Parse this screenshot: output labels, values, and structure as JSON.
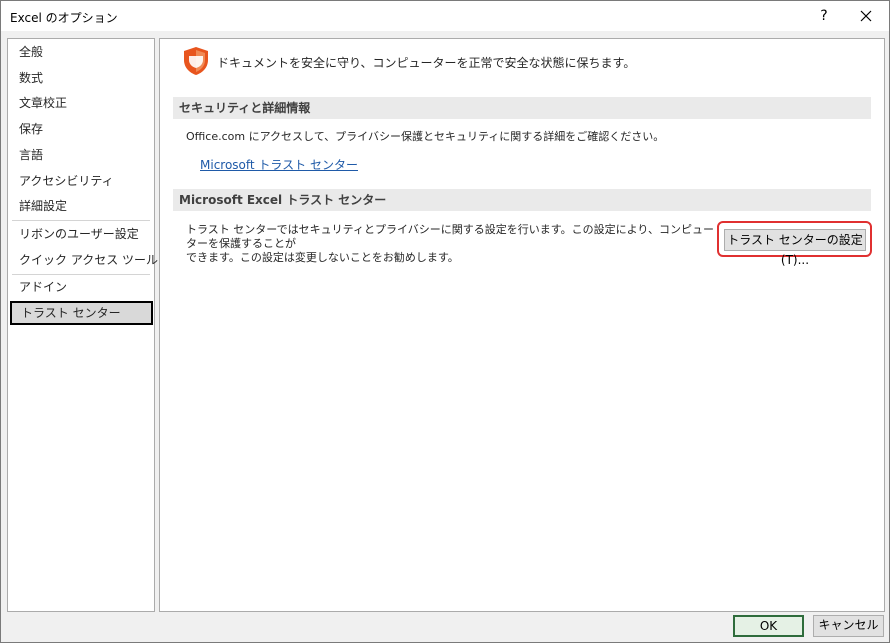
{
  "window": {
    "title": "Excel のオプション",
    "help_label": "?",
    "close_icon": "close-icon"
  },
  "sidebar": {
    "items": [
      {
        "label": "全般"
      },
      {
        "label": "数式"
      },
      {
        "label": "文章校正"
      },
      {
        "label": "保存"
      },
      {
        "label": "言語"
      },
      {
        "label": "アクセシビリティ"
      },
      {
        "label": "詳細設定"
      },
      {
        "label": "リボンのユーザー設定"
      },
      {
        "label": "クイック アクセス ツール バー"
      },
      {
        "label": "アドイン"
      },
      {
        "label": "トラスト センター"
      }
    ],
    "selected": "トラスト センター"
  },
  "main": {
    "header_icon": "shield-icon",
    "header_text": "ドキュメントを安全に守り、コンピューターを正常で安全な状態に保ちます。",
    "section1": {
      "title": "セキュリティと詳細情報",
      "text": "Office.com にアクセスして、プライバシー保護とセキュリティに関する詳細をご確認ください。",
      "link": "Microsoft トラスト センター"
    },
    "section2": {
      "title": "Microsoft Excel トラスト センター",
      "desc_line1": "トラスト センターではセキュリティとプライバシーに関する設定を行います。この設定により、コンピューターを保護することが",
      "desc_line2": "できます。この設定は変更しないことをお勧めします。",
      "button_label": "トラスト センターの設定(T)..."
    }
  },
  "footer": {
    "ok_label": "OK",
    "cancel_label": "キャンセル"
  },
  "colors": {
    "shield": "#e8551e",
    "highlight": "#e03030",
    "link": "#1f5aa8"
  }
}
